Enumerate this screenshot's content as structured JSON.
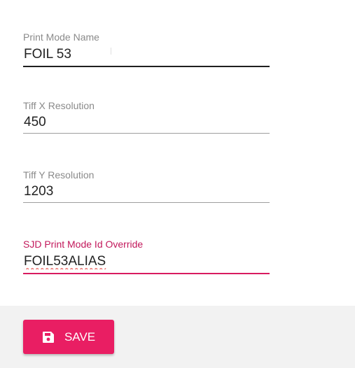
{
  "form": {
    "fields": [
      {
        "label": "Print Mode Name",
        "value": "FOIL 53"
      },
      {
        "label": "Tiff X Resolution",
        "value": "450"
      },
      {
        "label": "Tiff Y Resolution",
        "value": "1203"
      },
      {
        "label": "SJD Print Mode Id Override",
        "value": "FOIL53ALIAS"
      }
    ]
  },
  "actions": {
    "save_label": "SAVE",
    "save_icon": "floppy-disk-icon"
  },
  "colors": {
    "accent": "#e91e63",
    "focused_label": "#c2185b",
    "action_bar_bg": "#f2f2f2"
  }
}
